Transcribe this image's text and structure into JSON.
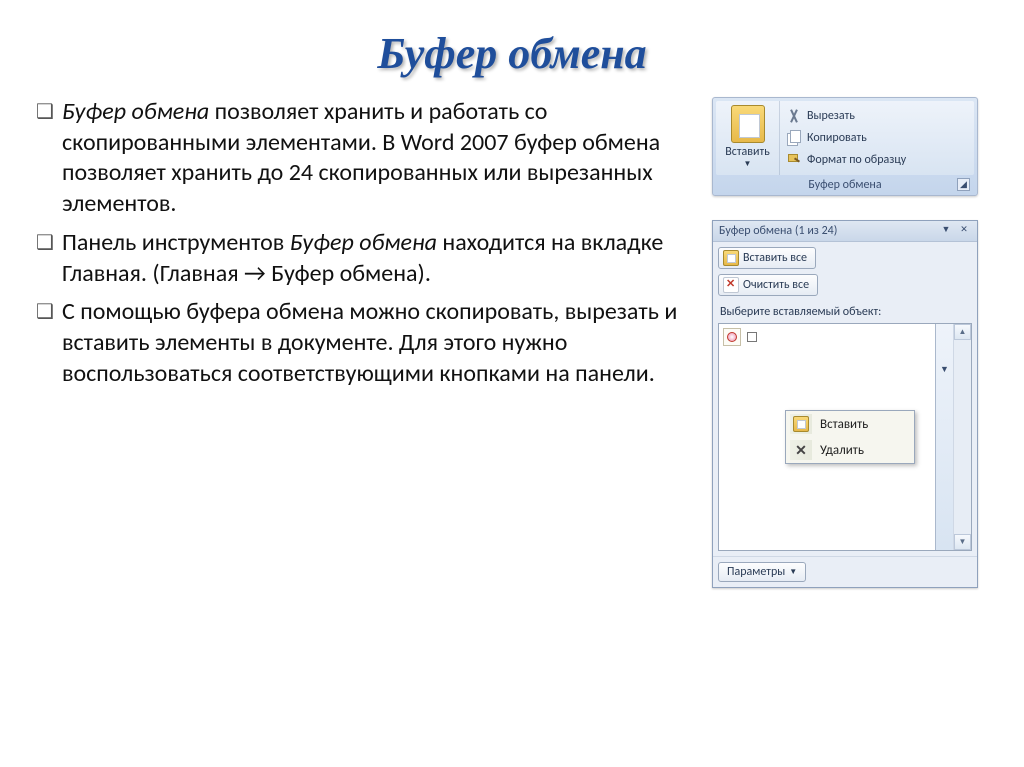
{
  "title": "Буфер обмена",
  "bullets": [
    {
      "pre_i": "Буфер обмена",
      "post": " позволяет хранить и работать со скопированными элементами. В Word 2007 буфер обмена позволяет хранить до 24 скопированных или вырезанных элементов."
    },
    {
      "pre": "Панель инструментов ",
      "i": "Буфер обмена",
      "post": " находится на вкладке Главная.  (Главная → Буфер обмена)."
    },
    {
      "post": "С помощью буфера обмена можно скопировать, вырезать и вставить элементы в документе. Для этого нужно воспользоваться соответствующими кнопками на панели."
    }
  ],
  "ribbon": {
    "paste": "Вставить",
    "cut": "Вырезать",
    "copy": "Копировать",
    "format": "Формат по образцу",
    "caption": "Буфер обмена"
  },
  "pane": {
    "title": "Буфер обмена (1 из 24)",
    "paste_all": "Вставить все",
    "clear_all": "Очистить все",
    "select_caption": "Выберите вставляемый объект:",
    "ctx_paste": "Вставить",
    "ctx_delete": "Удалить",
    "params": "Параметры"
  }
}
